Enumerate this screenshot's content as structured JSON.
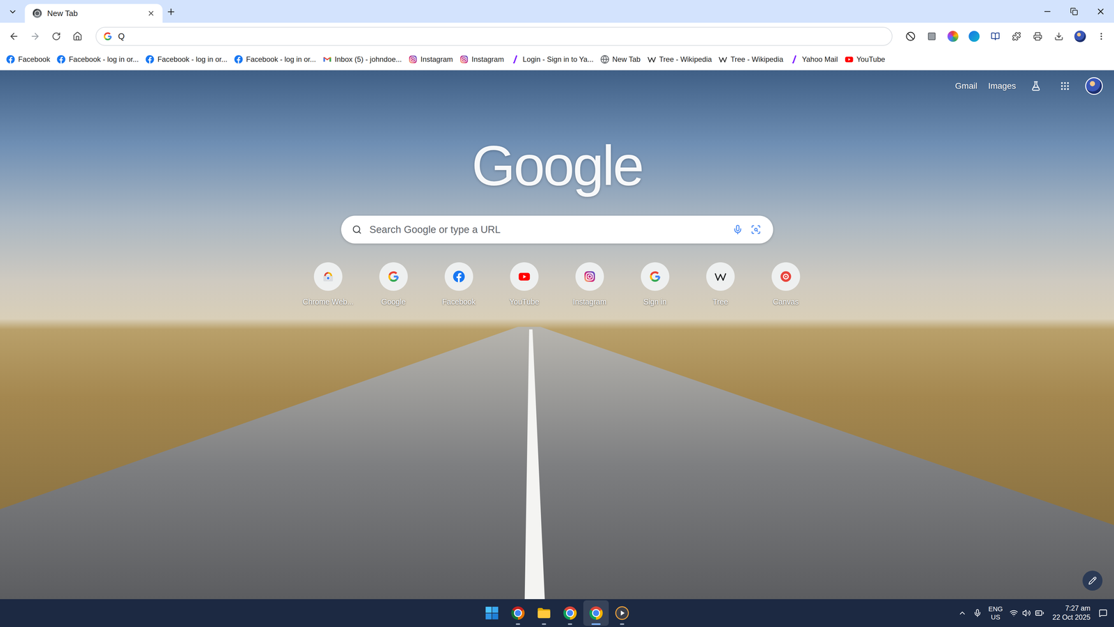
{
  "window": {
    "title": "New Tab"
  },
  "tabs": [
    {
      "label": "New Tab",
      "selected": true
    }
  ],
  "omnibox": {
    "value": "Q"
  },
  "bookmarks": [
    {
      "label": "Facebook",
      "kind": "facebook"
    },
    {
      "label": "Facebook - log in or...",
      "kind": "facebook"
    },
    {
      "label": "Facebook - log in or...",
      "kind": "facebook"
    },
    {
      "label": "Facebook - log in or...",
      "kind": "facebook"
    },
    {
      "label": "Inbox (5) - johndoe...",
      "kind": "gmail"
    },
    {
      "label": "Instagram",
      "kind": "instagram"
    },
    {
      "label": "Instagram",
      "kind": "instagram"
    },
    {
      "label": "Login - Sign in to Ya...",
      "kind": "yahoo"
    },
    {
      "label": "New Tab",
      "kind": "web"
    },
    {
      "label": "Tree - Wikipedia",
      "kind": "wikipedia"
    },
    {
      "label": "Tree - Wikipedia",
      "kind": "wikipedia"
    },
    {
      "label": "Yahoo Mail",
      "kind": "yahoo"
    },
    {
      "label": "YouTube",
      "kind": "youtube"
    }
  ],
  "header_links": [
    "Gmail",
    "Images"
  ],
  "logo": "Google",
  "search": {
    "placeholder": "Search Google or type a URL"
  },
  "shortcuts": [
    {
      "label": "Chrome Web...",
      "kind": "webstore"
    },
    {
      "label": "Google",
      "kind": "google"
    },
    {
      "label": "Facebook",
      "kind": "facebook"
    },
    {
      "label": "YouTube",
      "kind": "youtube"
    },
    {
      "label": "Instagram",
      "kind": "instagram"
    },
    {
      "label": "Sign in",
      "kind": "google"
    },
    {
      "label": "Tree",
      "kind": "wikipedia"
    },
    {
      "label": "Canvas",
      "kind": "canvas"
    }
  ],
  "taskbar": {
    "apps": [
      {
        "kind": "start",
        "running": false,
        "selected": false
      },
      {
        "kind": "chrome-dark",
        "running": true,
        "selected": false
      },
      {
        "kind": "files",
        "running": true,
        "selected": false
      },
      {
        "kind": "chrome",
        "running": true,
        "selected": false
      },
      {
        "kind": "chrome",
        "running": true,
        "selected": true
      },
      {
        "kind": "player",
        "running": true,
        "selected": false
      }
    ],
    "language": "ENG",
    "region": "US",
    "time": "7:27 am",
    "date": "22 Oct 2025"
  }
}
